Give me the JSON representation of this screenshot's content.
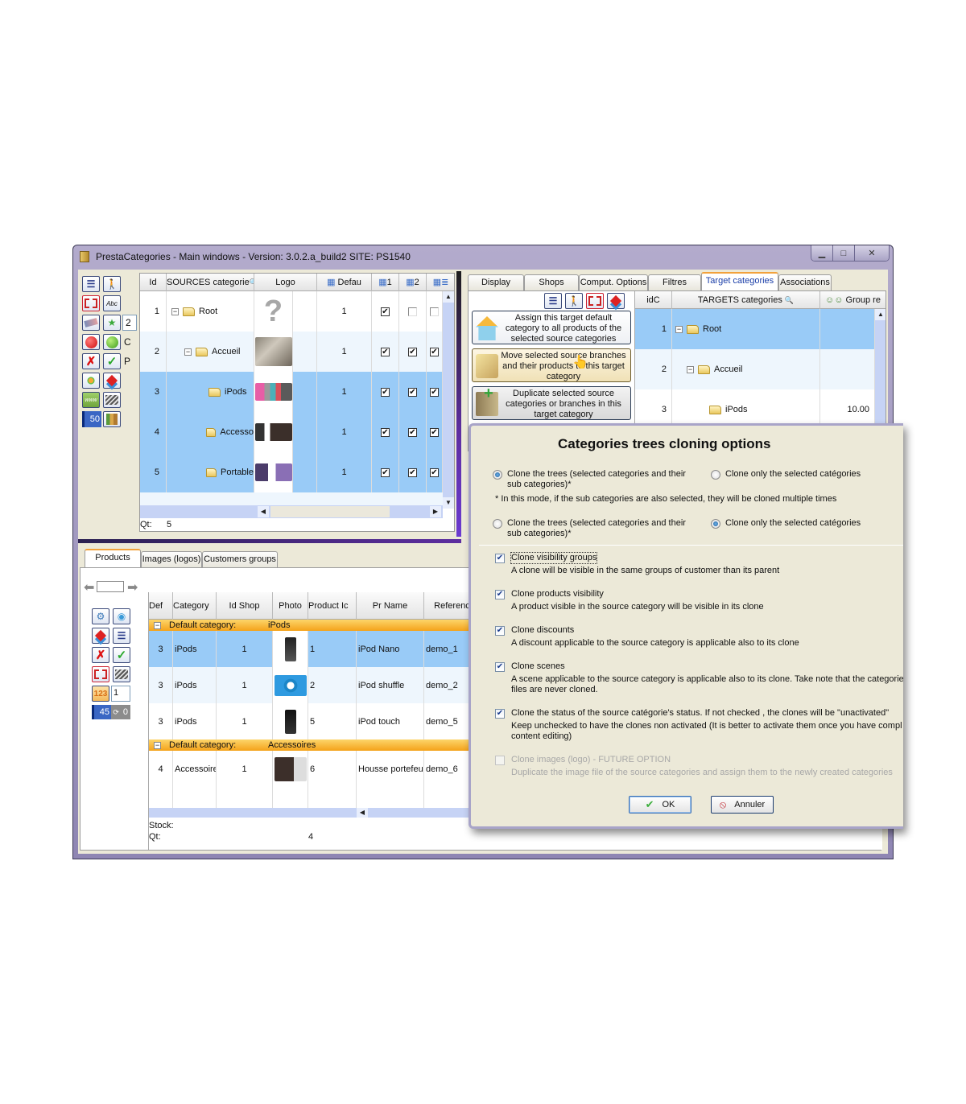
{
  "window": {
    "title": "PrestaCategories - Main windows  -  Version:  3.0.2.a_build2     SITE: PS1540",
    "minimize_icon": "minimize-icon",
    "maximize_icon": "maximize-icon",
    "close_icon": "close-icon"
  },
  "source_panel": {
    "toolbar": {
      "counter_box": "2",
      "label_c": "C",
      "label_p": "P",
      "page_size": "50"
    },
    "columns": [
      "Id",
      "SOURCES categorie",
      "Logo",
      "Defau",
      "1",
      "2",
      ""
    ],
    "rows": [
      {
        "id": "1",
        "name": "Root",
        "default": "1",
        "c1": true,
        "c2": false,
        "c3": false,
        "level": 0,
        "expander": "−"
      },
      {
        "id": "2",
        "name": "Accueil",
        "default": "1",
        "c1": true,
        "c2": true,
        "c3": true,
        "level": 1,
        "expander": "−"
      },
      {
        "id": "3",
        "name": "iPods",
        "default": "1",
        "c1": true,
        "c2": true,
        "c3": true,
        "level": 2,
        "expander": ""
      },
      {
        "id": "4",
        "name": "Accesso",
        "default": "1",
        "c1": true,
        "c2": true,
        "c3": true,
        "level": 2,
        "expander": ""
      },
      {
        "id": "5",
        "name": "Portable",
        "default": "1",
        "c1": true,
        "c2": true,
        "c3": true,
        "level": 2,
        "expander": ""
      }
    ],
    "footer_label": "Qt:",
    "footer_value": "5",
    "logo_placeholder": "?"
  },
  "right_tabs": [
    {
      "label": "Display",
      "active": false
    },
    {
      "label": "Shops",
      "active": false
    },
    {
      "label": "Comput. Options",
      "active": false
    },
    {
      "label": "Filtres",
      "active": false
    },
    {
      "label": "Target categories",
      "active": true
    },
    {
      "label": "Associations",
      "active": false
    }
  ],
  "target_panel": {
    "actions": [
      "Assign this target default category to all products of the selected source categories",
      "Move selected source branches and their products to this target category",
      "Duplicate selected source categories or branches in this target category"
    ],
    "columns": [
      "idC",
      "TARGETS categories",
      "Group re"
    ],
    "rows": [
      {
        "id": "1",
        "name": "Root",
        "group": "",
        "expander": "−"
      },
      {
        "id": "2",
        "name": "Accueil",
        "group": "",
        "expander": "−"
      },
      {
        "id": "3",
        "name": "iPods",
        "group": "10.00",
        "expander": ""
      }
    ]
  },
  "bottom_tabs": [
    {
      "label": "Products",
      "active": true
    },
    {
      "label": "Images (logos)",
      "active": false
    },
    {
      "label": "Customers groups",
      "active": false
    }
  ],
  "products_panel": {
    "nav_input": "",
    "qty_input": "1",
    "count_blue": "45",
    "count_gray": "0",
    "columns": [
      "Def",
      "Category",
      "Id Shop",
      "Photo",
      "Product Ic",
      "Pr Name",
      "Referenc"
    ],
    "groups": [
      {
        "label": "Default category:",
        "value": "iPods",
        "rows": [
          {
            "def": "3",
            "category": "iPods",
            "shop": "1",
            "product_id": "1",
            "name": "iPod Nano",
            "reference": "demo_1",
            "photo": "ipod-nano"
          },
          {
            "def": "3",
            "category": "iPods",
            "shop": "1",
            "product_id": "2",
            "name": "iPod shuffle",
            "reference": "demo_2",
            "photo": "ipod-shuffle"
          },
          {
            "def": "3",
            "category": "iPods",
            "shop": "1",
            "product_id": "5",
            "name": "iPod touch",
            "reference": "demo_5",
            "photo": "ipod-touch"
          }
        ]
      },
      {
        "label": "Default category:",
        "value": "Accessoires",
        "rows": [
          {
            "def": "4",
            "category": "Accessoire",
            "shop": "1",
            "product_id": "6",
            "name": "Housse portefeuil",
            "reference": "demo_6",
            "photo": "housse"
          }
        ]
      }
    ],
    "footer_stock": "Stock:",
    "footer_qt": "Qt:",
    "footer_qt_value": "4"
  },
  "dialog": {
    "title": "Categories trees cloning options",
    "radio_group_1": {
      "option_a": "Clone the trees (selected categories and their sub categories)*",
      "option_b": "Clone only the selected catégories",
      "selected": "a"
    },
    "note": "*  In this mode, if the sub categories are also selected, they will be cloned multiple times",
    "radio_group_2": {
      "option_a": "Clone the trees (selected categories and their sub categories)*",
      "option_b": "Clone only the selected catégories",
      "selected": "b"
    },
    "options": [
      {
        "label": "Clone visibility groups",
        "desc": "A clone will be visible in the same groups of customer than its parent",
        "checked": true,
        "enabled": true
      },
      {
        "label": "Clone products visibility",
        "desc": "A product visible in the source category will be visible in its clone",
        "checked": true,
        "enabled": true
      },
      {
        "label": "Clone discounts",
        "desc": "A discount applicable to the source category is applicable also to its clone",
        "checked": true,
        "enabled": true
      },
      {
        "label": "Clone scenes",
        "desc": "A scene applicable to the source category is applicable also to its clone. Take note that the categorie files are never cloned.",
        "checked": true,
        "enabled": true
      },
      {
        "label": "Clone the status of the source catégorie's status. If not checked , the clones will be \"unactivated\"",
        "desc": "Keep unchecked to have the clones non activated (It is better to activate them once you have compl content editing)",
        "checked": true,
        "enabled": true
      },
      {
        "label": "Clone images (logo) - FUTURE OPTION",
        "desc": "Duplicate the image file of the source categories and assign them to the newly created categories",
        "checked": false,
        "enabled": false
      }
    ],
    "ok_label": "OK",
    "cancel_label": "Annuler"
  }
}
